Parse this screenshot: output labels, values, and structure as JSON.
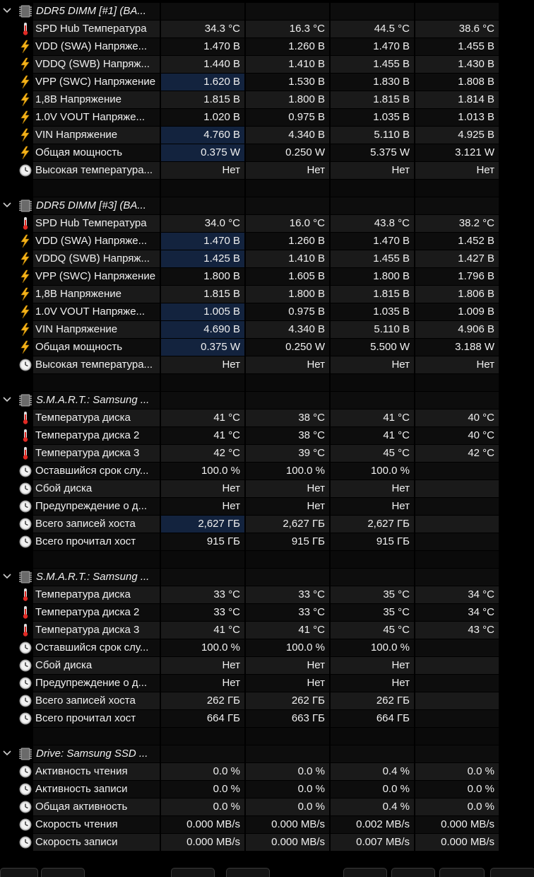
{
  "groups": [
    {
      "title": "DDR5 DIMM [#1] (BA...",
      "icon": "memory-chip-icon",
      "rows": [
        {
          "icon": "thermometer-icon",
          "label": "SPD Hub Температура",
          "values": [
            "34.3 °C",
            "16.3 °C",
            "44.5 °C",
            "38.6 °C"
          ],
          "highlight": [
            false,
            false,
            false,
            false
          ]
        },
        {
          "icon": "voltage-bolt-icon",
          "label": "VDD (SWA) Напряже...",
          "values": [
            "1.470 В",
            "1.260 В",
            "1.470 В",
            "1.455 В"
          ],
          "highlight": [
            false,
            false,
            false,
            false
          ]
        },
        {
          "icon": "voltage-bolt-icon",
          "label": "VDDQ (SWB) Напряж...",
          "values": [
            "1.440 В",
            "1.410 В",
            "1.455 В",
            "1.430 В"
          ],
          "highlight": [
            false,
            false,
            false,
            false
          ]
        },
        {
          "icon": "voltage-bolt-icon",
          "label": "VPP (SWC) Напряжение",
          "values": [
            "1.620 В",
            "1.530 В",
            "1.830 В",
            "1.808 В"
          ],
          "highlight": [
            true,
            false,
            false,
            false
          ]
        },
        {
          "icon": "voltage-bolt-icon",
          "label": "1,8В Напряжение",
          "values": [
            "1.815 В",
            "1.800 В",
            "1.815 В",
            "1.814 В"
          ],
          "highlight": [
            false,
            false,
            false,
            false
          ]
        },
        {
          "icon": "voltage-bolt-icon",
          "label": "1.0V VOUT Напряже...",
          "values": [
            "1.020 В",
            "0.975 В",
            "1.035 В",
            "1.013 В"
          ],
          "highlight": [
            false,
            false,
            false,
            false
          ]
        },
        {
          "icon": "voltage-bolt-icon",
          "label": "VIN Напряжение",
          "values": [
            "4.760 В",
            "4.340 В",
            "5.110 В",
            "4.925 В"
          ],
          "highlight": [
            true,
            false,
            false,
            false
          ]
        },
        {
          "icon": "voltage-bolt-icon",
          "label": "Общая мощность",
          "values": [
            "0.375 W",
            "0.250 W",
            "5.375 W",
            "3.121 W"
          ],
          "highlight": [
            true,
            false,
            false,
            false
          ]
        },
        {
          "icon": "clock-icon",
          "label": "Высокая температура...",
          "values": [
            "Нет",
            "Нет",
            "Нет",
            "Нет"
          ],
          "highlight": [
            false,
            false,
            false,
            false
          ]
        }
      ]
    },
    {
      "title": "DDR5 DIMM [#3] (BA...",
      "icon": "memory-chip-icon",
      "rows": [
        {
          "icon": "thermometer-icon",
          "label": "SPD Hub Температура",
          "values": [
            "34.0 °C",
            "16.0 °C",
            "43.8 °C",
            "38.2 °C"
          ],
          "highlight": [
            false,
            false,
            false,
            false
          ]
        },
        {
          "icon": "voltage-bolt-icon",
          "label": "VDD (SWA) Напряже...",
          "values": [
            "1.470 В",
            "1.260 В",
            "1.470 В",
            "1.452 В"
          ],
          "highlight": [
            true,
            false,
            false,
            false
          ]
        },
        {
          "icon": "voltage-bolt-icon",
          "label": "VDDQ (SWB) Напряж...",
          "values": [
            "1.425 В",
            "1.410 В",
            "1.455 В",
            "1.427 В"
          ],
          "highlight": [
            true,
            false,
            false,
            false
          ]
        },
        {
          "icon": "voltage-bolt-icon",
          "label": "VPP (SWC) Напряжение",
          "values": [
            "1.800 В",
            "1.605 В",
            "1.800 В",
            "1.796 В"
          ],
          "highlight": [
            false,
            false,
            false,
            false
          ]
        },
        {
          "icon": "voltage-bolt-icon",
          "label": "1,8В Напряжение",
          "values": [
            "1.815 В",
            "1.800 В",
            "1.815 В",
            "1.806 В"
          ],
          "highlight": [
            false,
            false,
            false,
            false
          ]
        },
        {
          "icon": "voltage-bolt-icon",
          "label": "1.0V VOUT Напряже...",
          "values": [
            "1.005 В",
            "0.975 В",
            "1.035 В",
            "1.009 В"
          ],
          "highlight": [
            true,
            false,
            false,
            false
          ]
        },
        {
          "icon": "voltage-bolt-icon",
          "label": "VIN Напряжение",
          "values": [
            "4.690 В",
            "4.340 В",
            "5.110 В",
            "4.906 В"
          ],
          "highlight": [
            true,
            false,
            false,
            false
          ]
        },
        {
          "icon": "voltage-bolt-icon",
          "label": "Общая мощность",
          "values": [
            "0.375 W",
            "0.250 W",
            "5.500 W",
            "3.188 W"
          ],
          "highlight": [
            true,
            false,
            false,
            false
          ]
        },
        {
          "icon": "clock-icon",
          "label": "Высокая температура...",
          "values": [
            "Нет",
            "Нет",
            "Нет",
            "Нет"
          ],
          "highlight": [
            false,
            false,
            false,
            false
          ]
        }
      ]
    },
    {
      "title": "S.M.A.R.T.: Samsung ...",
      "icon": "memory-chip-icon",
      "rows": [
        {
          "icon": "thermometer-icon",
          "label": "Температура диска",
          "values": [
            "41 °C",
            "38 °C",
            "41 °C",
            "40 °C"
          ],
          "highlight": [
            false,
            false,
            false,
            false
          ]
        },
        {
          "icon": "thermometer-icon",
          "label": "Температура диска 2",
          "values": [
            "41 °C",
            "38 °C",
            "41 °C",
            "40 °C"
          ],
          "highlight": [
            false,
            false,
            false,
            false
          ]
        },
        {
          "icon": "thermometer-icon",
          "label": "Температура диска 3",
          "values": [
            "42 °C",
            "39 °C",
            "45 °C",
            "42 °C"
          ],
          "highlight": [
            false,
            false,
            false,
            false
          ]
        },
        {
          "icon": "clock-icon",
          "label": "Оставшийся срок слу...",
          "values": [
            "100.0 %",
            "100.0 %",
            "100.0 %",
            ""
          ],
          "highlight": [
            false,
            false,
            false,
            false
          ]
        },
        {
          "icon": "clock-icon",
          "label": "Сбой диска",
          "values": [
            "Нет",
            "Нет",
            "Нет",
            ""
          ],
          "highlight": [
            false,
            false,
            false,
            false
          ]
        },
        {
          "icon": "clock-icon",
          "label": "Предупреждение о д...",
          "values": [
            "Нет",
            "Нет",
            "Нет",
            ""
          ],
          "highlight": [
            false,
            false,
            false,
            false
          ]
        },
        {
          "icon": "clock-icon",
          "label": "Всего записей хоста",
          "values": [
            "2,627 ГБ",
            "2,627 ГБ",
            "2,627 ГБ",
            ""
          ],
          "highlight": [
            true,
            false,
            false,
            false
          ]
        },
        {
          "icon": "clock-icon",
          "label": "Всего прочитал хост",
          "values": [
            "915 ГБ",
            "915 ГБ",
            "915 ГБ",
            ""
          ],
          "highlight": [
            false,
            false,
            false,
            false
          ]
        }
      ]
    },
    {
      "title": "S.M.A.R.T.: Samsung ...",
      "icon": "memory-chip-icon",
      "rows": [
        {
          "icon": "thermometer-icon",
          "label": "Температура диска",
          "values": [
            "33 °C",
            "33 °C",
            "35 °C",
            "34 °C"
          ],
          "highlight": [
            false,
            false,
            false,
            false
          ]
        },
        {
          "icon": "thermometer-icon",
          "label": "Температура диска 2",
          "values": [
            "33 °C",
            "33 °C",
            "35 °C",
            "34 °C"
          ],
          "highlight": [
            false,
            false,
            false,
            false
          ]
        },
        {
          "icon": "thermometer-icon",
          "label": "Температура диска 3",
          "values": [
            "41 °C",
            "41 °C",
            "45 °C",
            "43 °C"
          ],
          "highlight": [
            false,
            false,
            false,
            false
          ]
        },
        {
          "icon": "clock-icon",
          "label": "Оставшийся срок слу...",
          "values": [
            "100.0 %",
            "100.0 %",
            "100.0 %",
            ""
          ],
          "highlight": [
            false,
            false,
            false,
            false
          ]
        },
        {
          "icon": "clock-icon",
          "label": "Сбой диска",
          "values": [
            "Нет",
            "Нет",
            "Нет",
            ""
          ],
          "highlight": [
            false,
            false,
            false,
            false
          ]
        },
        {
          "icon": "clock-icon",
          "label": "Предупреждение о д...",
          "values": [
            "Нет",
            "Нет",
            "Нет",
            ""
          ],
          "highlight": [
            false,
            false,
            false,
            false
          ]
        },
        {
          "icon": "clock-icon",
          "label": "Всего записей хоста",
          "values": [
            "262 ГБ",
            "262 ГБ",
            "262 ГБ",
            ""
          ],
          "highlight": [
            false,
            false,
            false,
            false
          ]
        },
        {
          "icon": "clock-icon",
          "label": "Всего прочитал хост",
          "values": [
            "664 ГБ",
            "663 ГБ",
            "664 ГБ",
            ""
          ],
          "highlight": [
            false,
            false,
            false,
            false
          ]
        }
      ]
    },
    {
      "title": "Drive: Samsung SSD ...",
      "icon": "memory-chip-icon",
      "rows": [
        {
          "icon": "clock-icon",
          "label": "Активность чтения",
          "values": [
            "0.0 %",
            "0.0 %",
            "0.4 %",
            "0.0 %"
          ],
          "highlight": [
            false,
            false,
            false,
            false
          ]
        },
        {
          "icon": "clock-icon",
          "label": "Активность записи",
          "values": [
            "0.0 %",
            "0.0 %",
            "0.0 %",
            "0.0 %"
          ],
          "highlight": [
            false,
            false,
            false,
            false
          ]
        },
        {
          "icon": "clock-icon",
          "label": "Общая активность",
          "values": [
            "0.0 %",
            "0.0 %",
            "0.4 %",
            "0.0 %"
          ],
          "highlight": [
            false,
            false,
            false,
            false
          ]
        },
        {
          "icon": "clock-icon",
          "label": "Скорость чтения",
          "values": [
            "0.000 MB/s",
            "0.000 MB/s",
            "0.002 MB/s",
            "0.000 MB/s"
          ],
          "highlight": [
            false,
            false,
            false,
            false
          ]
        },
        {
          "icon": "clock-icon",
          "label": "Скорость записи",
          "values": [
            "0.000 MB/s",
            "0.000 MB/s",
            "0.007 MB/s",
            "0.000 MB/s"
          ],
          "highlight": [
            false,
            false,
            false,
            false
          ]
        }
      ]
    }
  ],
  "colors": {
    "background": "#000000",
    "row": "#0d0d0d",
    "row_alt": "#1a1a1a",
    "highlight": "#13233e",
    "text": "#f0f0f0",
    "bolt": "#f4b21a",
    "thermo": "#e02a24"
  }
}
